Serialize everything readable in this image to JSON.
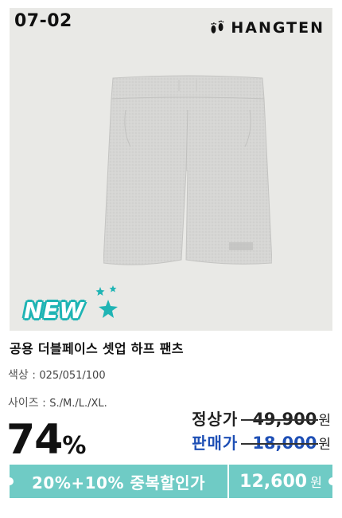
{
  "product": {
    "code": "07-02",
    "brand": "HANGTEN",
    "badge": "NEW",
    "title": "공용 더블페이스 셋업 하프 팬츠",
    "color_label": "색상 : ",
    "color_value": "025/051/100",
    "size_label": "사이즈 : ",
    "size_value": "S./M./L./XL."
  },
  "pricing": {
    "discount_number": "74",
    "discount_symbol": "%",
    "regular_label": "정상가",
    "regular_price": "49,900",
    "sale_label": "판매가",
    "sale_price": "18,000",
    "currency": "원"
  },
  "promo": {
    "text": "20%+10% 중복할인가",
    "final_price": "12,600",
    "currency": "원"
  },
  "colors": {
    "accent_teal": "#6fcbc5",
    "sale_blue": "#1e4fb5",
    "image_bg": "#e9e9e6"
  },
  "icons": {
    "brand_logo": "footprints-icon",
    "badge_decoration": "sparkle-stars-icon"
  }
}
